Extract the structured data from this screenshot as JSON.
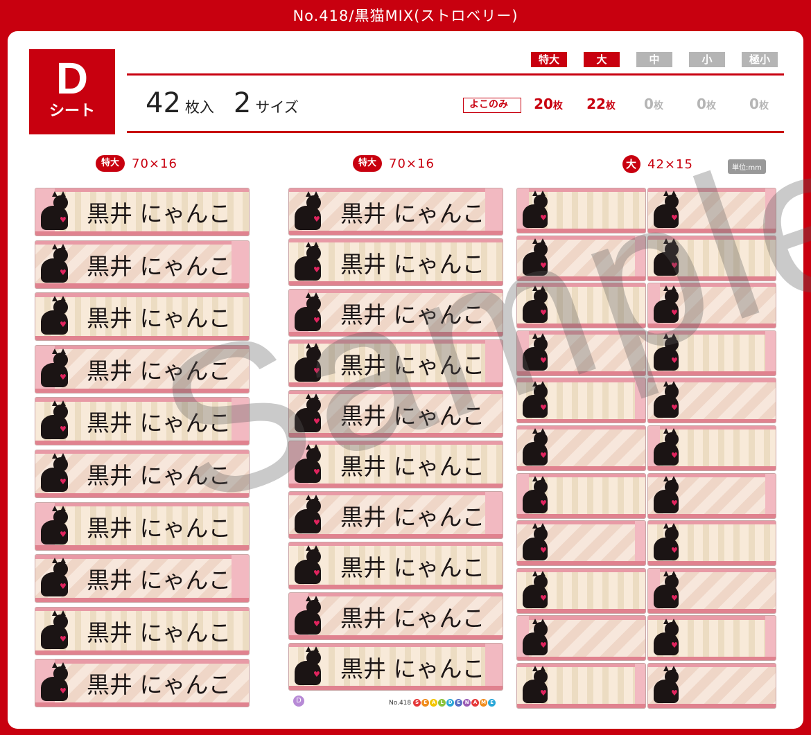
{
  "title": "No.418/黒猫MIX(ストロベリー)",
  "sheet": {
    "letter": "D",
    "sub": "シート"
  },
  "summary": {
    "count": "42",
    "count_unit": "枚入",
    "sizes": "2",
    "sizes_unit": "サイズ"
  },
  "size_headers": [
    {
      "label": "特大",
      "active": true
    },
    {
      "label": "大",
      "active": true
    },
    {
      "label": "中",
      "active": false
    },
    {
      "label": "小",
      "active": false
    },
    {
      "label": "極小",
      "active": false
    }
  ],
  "yoko_label": "よこのみ",
  "quantities": [
    {
      "num": "20",
      "unit": "枚",
      "active": true
    },
    {
      "num": "22",
      "unit": "枚",
      "active": true
    },
    {
      "num": "0",
      "unit": "枚",
      "active": false
    },
    {
      "num": "0",
      "unit": "枚",
      "active": false
    },
    {
      "num": "0",
      "unit": "枚",
      "active": false
    }
  ],
  "columns": [
    {
      "badge": "特大",
      "dims": "70×16"
    },
    {
      "badge": "特大",
      "dims": "70×16"
    },
    {
      "badge": "大",
      "dims": "42×15"
    }
  ],
  "unit_note": "単位:mm",
  "label_name": "黒井 にゃんこ",
  "watermark": "Sample",
  "footer": {
    "badge": "D",
    "code": "No.418",
    "brand": "SEALDENAME"
  },
  "colors": {
    "accent": "#c8000f",
    "inactive": "#b5b5b5",
    "label_pink": "#e89aa6"
  }
}
